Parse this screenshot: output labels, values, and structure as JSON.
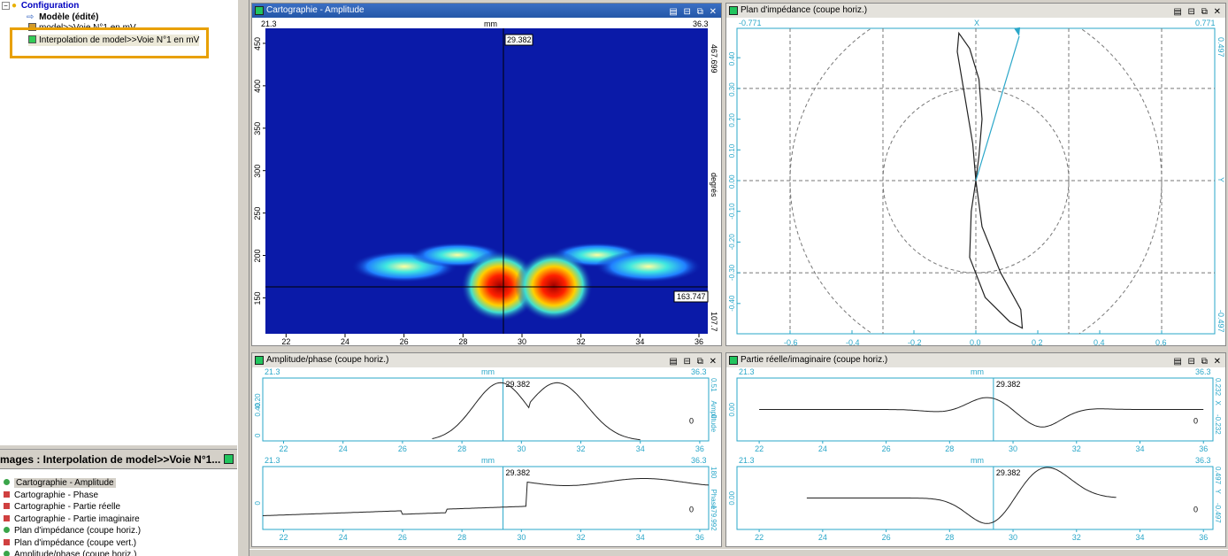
{
  "tree": {
    "root": "Configuration",
    "model": "Modèle (édité)",
    "item1": "model>>Voie N°1 en mV",
    "item2": "Interpolation de model>>Voie N°1 en mV"
  },
  "images_header": "mages : Interpolation de model>>Voie N°1...",
  "images_list": [
    {
      "label": "Cartographie - Amplitude",
      "marker": "dot",
      "color": "#3aa54a",
      "selected": true
    },
    {
      "label": "Cartographie - Phase",
      "marker": "sq",
      "color": "#d04040"
    },
    {
      "label": "Cartographie - Partie réelle",
      "marker": "sq",
      "color": "#d04040"
    },
    {
      "label": "Cartographie - Partie imaginaire",
      "marker": "sq",
      "color": "#d04040"
    },
    {
      "label": "Plan d'impédance (coupe horiz.)",
      "marker": "dot",
      "color": "#3aa54a"
    },
    {
      "label": "Plan d'impédance (coupe vert.)",
      "marker": "sq",
      "color": "#d04040"
    },
    {
      "label": "Amplitude/phase (coupe horiz.)",
      "marker": "dot",
      "color": "#3aa54a"
    }
  ],
  "panels": {
    "carto": {
      "title": "Cartographie - Amplitude",
      "x_left": "21.3",
      "x_unit": "mm",
      "x_right": "36.3",
      "y_right_top": "467.699",
      "y_right_unit": "degrés",
      "y_right_bottom": "107.7",
      "cursor_x": "29.382",
      "cursor_y": "163.747",
      "y_ticks": [
        "450",
        "400",
        "350",
        "300",
        "250",
        "200",
        "150"
      ],
      "x_ticks": [
        "22",
        "24",
        "26",
        "28",
        "30",
        "32",
        "34",
        "36"
      ]
    },
    "impedance": {
      "title": "Plan d'impédance (coupe horiz.)",
      "x_left": "-0.771",
      "x_axis": "X",
      "x_right": "0.771",
      "y_right_top": "0.497",
      "y_right_axis": "Y",
      "y_right_bottom": "-0.497",
      "y_ticks": [
        "0.40",
        "0.30",
        "0.20",
        "0.10",
        "0.00",
        "-0.10",
        "-0.20",
        "-0.30",
        "-0.40"
      ],
      "x_ticks": [
        "-0.6",
        "-0.4",
        "-0.2",
        "0.0",
        "0.2",
        "0.4",
        "0.6"
      ]
    },
    "ampphase": {
      "title": "Amplitude/phase (coupe horiz.)",
      "top": {
        "x_left": "21.3",
        "x_unit": "mm",
        "x_right": "36.3",
        "cursor": "29.382",
        "r_top": "0.51",
        "r_label": "Amplitude",
        "r_bottom": "0",
        "zero": "0",
        "y_ticks": [
          "0.40",
          "0.20",
          "0"
        ]
      },
      "bottom": {
        "x_left": "21.3",
        "x_unit": "mm",
        "x_right": "36.3",
        "cursor": "29.382",
        "r_top": "180",
        "r_label": "Phase",
        "r_bottom": "-179.992",
        "zero": "0",
        "y_ticks": [
          "0"
        ]
      },
      "x_ticks": [
        "22",
        "24",
        "26",
        "28",
        "30",
        "32",
        "34",
        "36"
      ]
    },
    "reim": {
      "title": "Partie réelle/imaginaire (coupe horiz.)",
      "top": {
        "x_left": "21.3",
        "x_unit": "mm",
        "x_right": "36.3",
        "cursor": "29.382",
        "r_top": "0.232",
        "r_label": "X",
        "r_bottom": "-0.232",
        "zero": "0",
        "y_ticks": [
          "0.00"
        ]
      },
      "bottom": {
        "x_left": "21.3",
        "x_unit": "mm",
        "x_right": "36.3",
        "cursor": "29.382",
        "r_top": "0.497",
        "r_label": "Y",
        "r_bottom": "-0.497",
        "zero": "0",
        "y_ticks": [
          "0.00"
        ]
      },
      "x_ticks": [
        "22",
        "24",
        "26",
        "28",
        "30",
        "32",
        "34",
        "36"
      ]
    }
  },
  "colors": {
    "accent": "#2aa7c9",
    "title_active": "#2f66bd"
  }
}
